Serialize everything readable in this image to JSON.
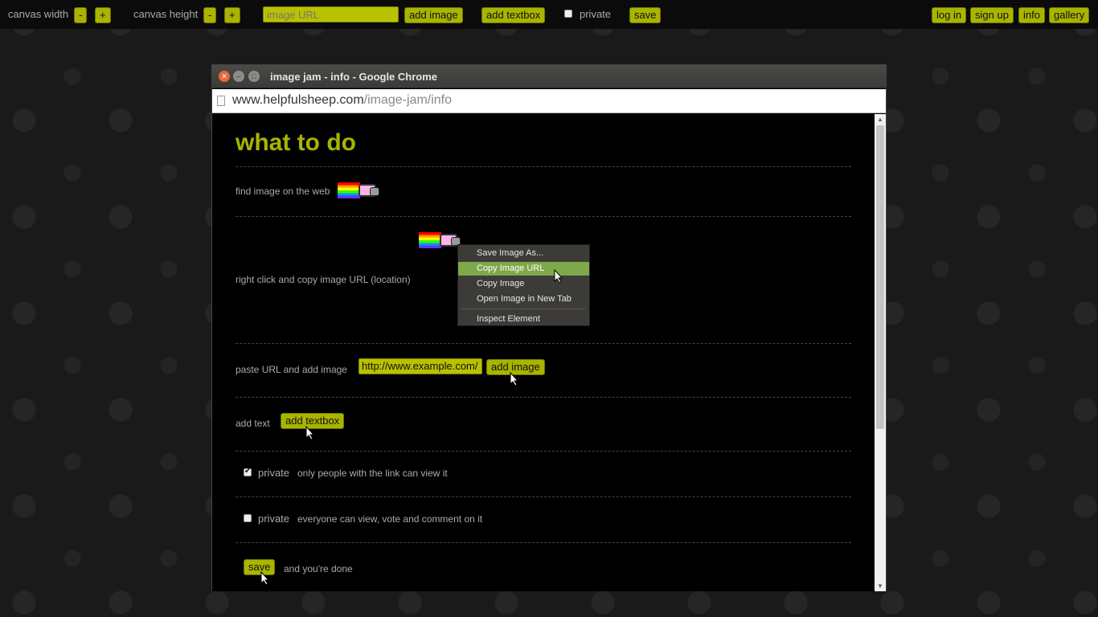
{
  "toolbar": {
    "canvas_width_label": "canvas width",
    "canvas_height_label": "canvas height",
    "minus": "-",
    "plus": "+",
    "image_url_placeholder": "image URL",
    "add_image": "add image",
    "add_textbox": "add textbox",
    "private_label": "private",
    "save": "save",
    "log_in": "log in",
    "sign_up": "sign up",
    "info": "info",
    "gallery": "gallery"
  },
  "browser": {
    "title": "image jam - info - Google Chrome",
    "url_host": "www.helpfulsheep.com",
    "url_path": "/image-jam/info"
  },
  "page": {
    "title": "what to do",
    "step1": "find image on the web",
    "step2": "right click and copy image URL (location)",
    "context_menu": {
      "items": [
        "Save Image As...",
        "Copy Image URL",
        "Copy Image",
        "Open Image in New Tab",
        "Inspect Element"
      ],
      "highlighted": "Copy Image URL"
    },
    "step3": "paste URL and add image",
    "step3_url_value": "http://www.example.com/",
    "step3_button": "add image",
    "step4": "add text",
    "step4_button": "add textbox",
    "private_checked_label": "private",
    "private_checked_desc": "only people with the link can view it",
    "private_unchecked_label": "private",
    "private_unchecked_desc": "everyone can view, vote and comment on it",
    "save_button": "save",
    "save_desc": "and you're done"
  },
  "colors": {
    "accent": "#a8b400",
    "menu_highlight": "#7ea84a"
  }
}
